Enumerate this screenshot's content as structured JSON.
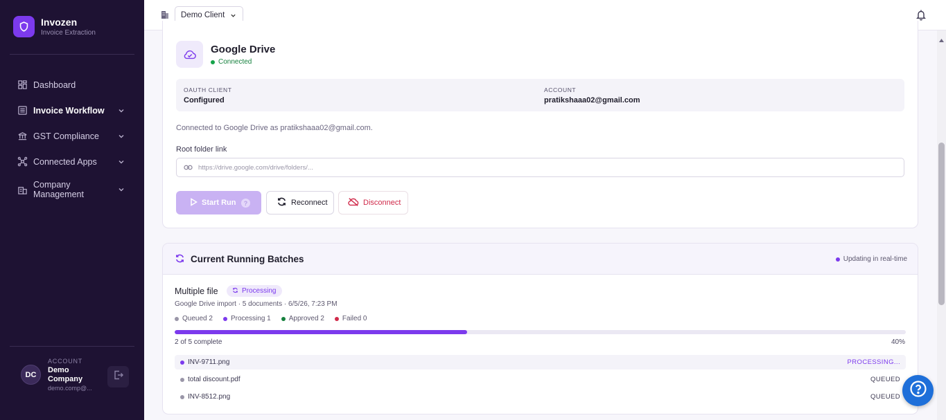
{
  "brand": {
    "name": "Invozen",
    "subtitle": "Invoice Extraction"
  },
  "nav": {
    "items": [
      {
        "label": "Dashboard",
        "icon": "dashboard-icon"
      },
      {
        "label": "Invoice Workflow",
        "icon": "list-icon"
      },
      {
        "label": "GST Compliance",
        "icon": "bank-icon"
      },
      {
        "label": "Connected Apps",
        "icon": "apps-network-icon"
      },
      {
        "label": "Company Management",
        "icon": "building-icon"
      }
    ]
  },
  "account": {
    "caption": "ACCOUNT",
    "name": "Demo Company",
    "email": "demo.comp@...",
    "initials": "DC"
  },
  "topbar": {
    "client": "Demo Client"
  },
  "gdrive": {
    "title": "Google Drive",
    "status": "Connected",
    "oauth_caption": "OAUTH CLIENT",
    "oauth_value": "Configured",
    "account_caption": "ACCOUNT",
    "account_value": "pratikshaaa02@gmail.com",
    "note": "Connected to Google Drive as pratikshaaa02@gmail.com.",
    "root_label": "Root folder link",
    "root_placeholder": "https://drive.google.com/drive/folders/...",
    "start_label": "Start Run",
    "start_help": "?",
    "reconnect_label": "Reconnect",
    "disconnect_label": "Disconnect"
  },
  "batches": {
    "title": "Current Running Batches",
    "realtime": "Updating in real-time",
    "batch": {
      "name": "Multiple file",
      "status": "Processing",
      "meta": "Google Drive import · 5 documents · 6/5/26, 7:23 PM",
      "counts": [
        {
          "label": "Queued 2",
          "color": "#9a96a8"
        },
        {
          "label": "Processing 1",
          "color": "#7c3aed"
        },
        {
          "label": "Approved 2",
          "color": "#15803d"
        },
        {
          "label": "Failed 0",
          "color": "#d02a4a"
        }
      ],
      "progress": 0.4,
      "progress_text": "2 of 5 complete",
      "progress_pct": "40%",
      "files": [
        {
          "name": "INV-9711.png",
          "status": "PROCESSING...",
          "color": "#7c3aed"
        },
        {
          "name": "total discount.pdf",
          "status": "QUEUED",
          "color": "#9a96a8"
        },
        {
          "name": "INV-8512.png",
          "status": "QUEUED",
          "color": "#9a96a8"
        }
      ]
    }
  },
  "colors": {
    "accent": "#7c3aed",
    "sidebar": "#1e1233",
    "success": "#15803d",
    "danger": "#d02a4a",
    "help": "#1e6fd9"
  }
}
